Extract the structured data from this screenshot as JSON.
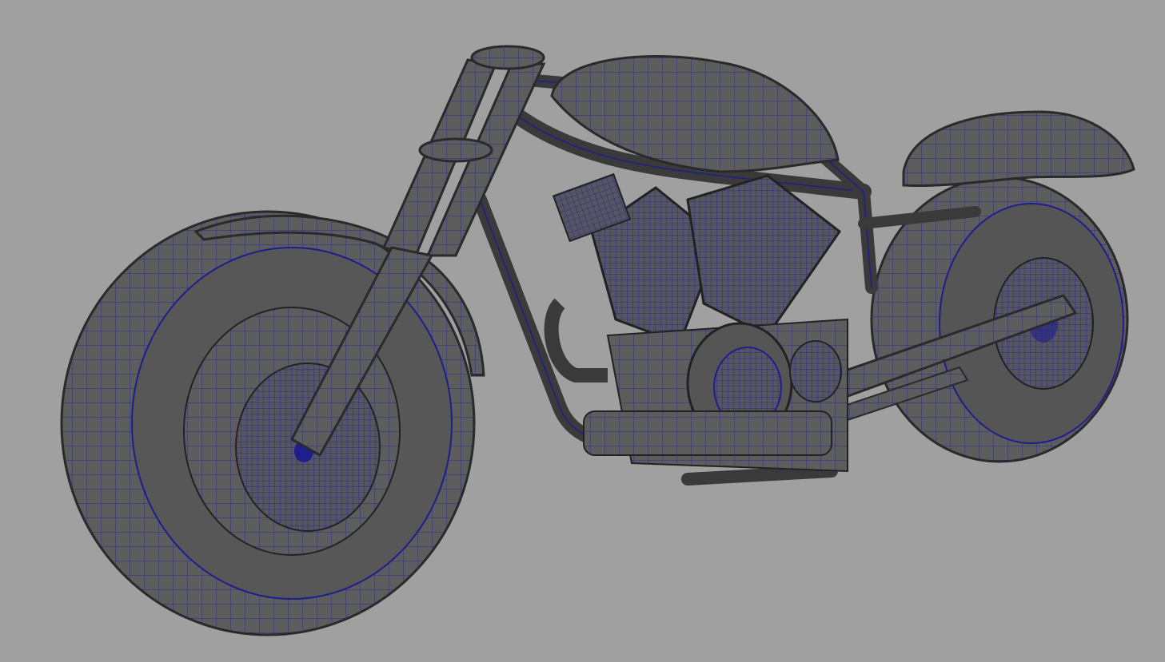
{
  "viewport": {
    "background_color": "#a0a0a0",
    "shaded_color": "#5a5a5a",
    "wire_color": "#1e1e8c",
    "model_name_semantic": "motorcycle-wireframe-model"
  }
}
